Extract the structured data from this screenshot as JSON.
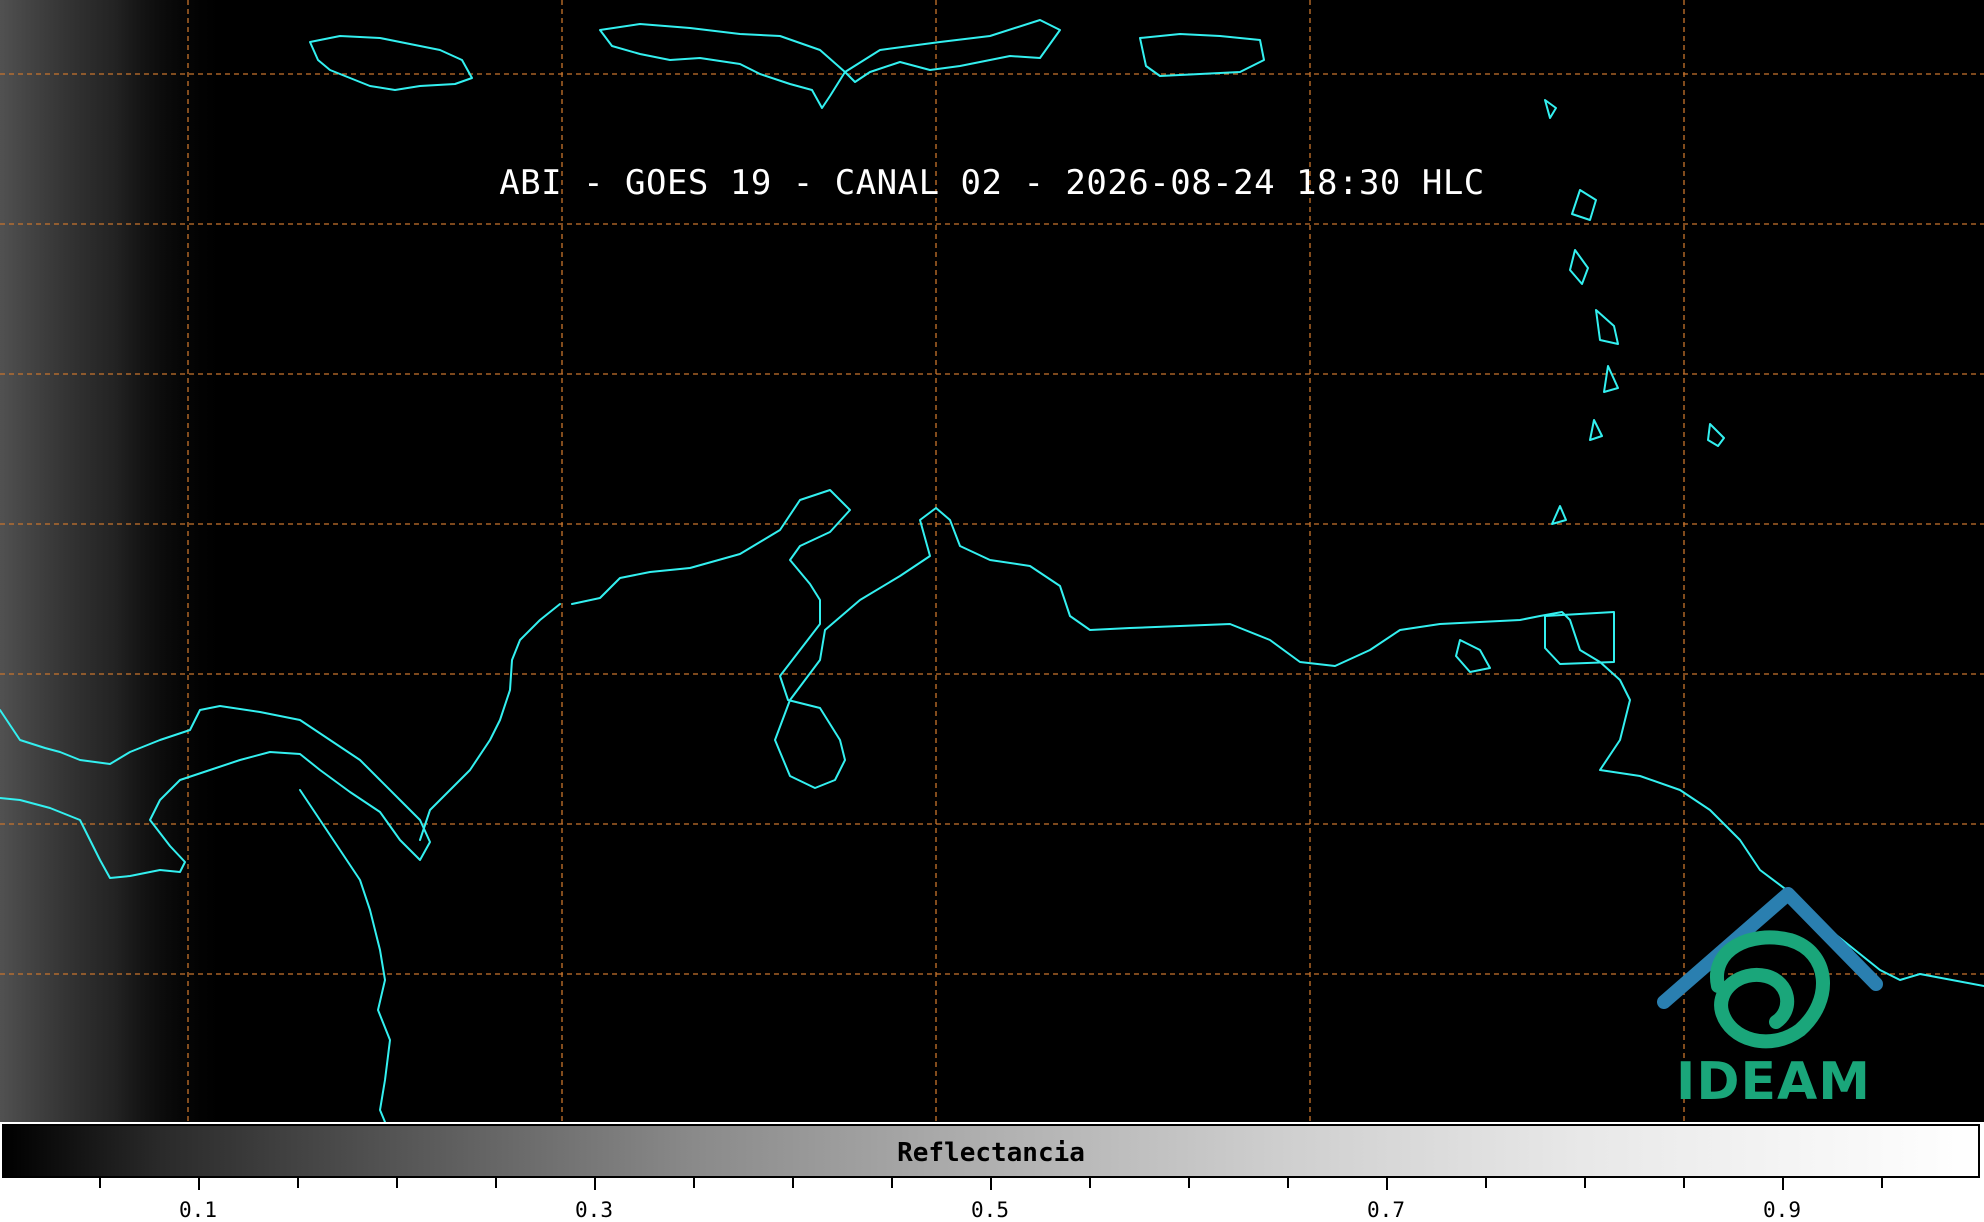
{
  "title": "ABI - GOES 19 - CANAL 02 - 2026-08-24 18:30 HLC",
  "logo": {
    "text": "IDEAM",
    "icon": "ideam-logo-icon",
    "colors": {
      "roof": "#2a7fb0",
      "swirl": "#1aa67a"
    }
  },
  "colorbar": {
    "label": "Reflectancia",
    "ticks": [
      "0.1",
      "0.3",
      "0.5",
      "0.7",
      "0.9"
    ],
    "range": [
      0.0,
      1.0
    ],
    "colormap": "grayscale"
  },
  "map": {
    "projection": "geographic",
    "grid": "dashed lat/lon lines",
    "colors": {
      "background": "#000000",
      "coastline": "#33f0f0",
      "grid": "#c8742c"
    }
  }
}
